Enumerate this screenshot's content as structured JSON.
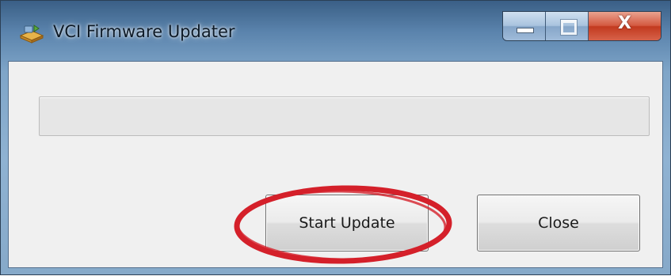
{
  "window": {
    "title": "VCI Firmware Updater",
    "app_icon": "updater-app-icon",
    "caption_buttons": {
      "minimize_icon": "minimize-icon",
      "maximize_icon": "maximize-icon",
      "close_icon": "close-icon",
      "close_glyph": "X"
    }
  },
  "progress": {
    "value": 0
  },
  "buttons": {
    "start_update_label": "Start Update",
    "close_label": "Close"
  },
  "annotation": {
    "highlight_color": "#d4202a",
    "target": "start-update-button"
  },
  "colors": {
    "title_bar": "#5b84ad",
    "close_button": "#c23a1f",
    "client_background": "#f0f0f0"
  }
}
